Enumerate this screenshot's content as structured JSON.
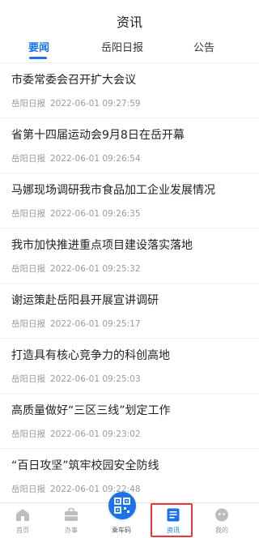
{
  "header": {
    "title": "资讯",
    "tabs": [
      {
        "label": "要闻",
        "active": true
      },
      {
        "label": "岳阳日报",
        "active": false
      },
      {
        "label": "公告",
        "active": false
      }
    ]
  },
  "news": [
    {
      "title": "市委常委会召开扩大会议",
      "source": "岳阳日报",
      "time": "2022-06-01 09:27:59"
    },
    {
      "title": "省第十四届运动会9月8日在岳开幕",
      "source": "岳阳日报",
      "time": "2022-06-01 09:26:54"
    },
    {
      "title": "马娜现场调研我市食品加工企业发展情况",
      "source": "岳阳日报",
      "time": "2022-06-01 09:26:35"
    },
    {
      "title": "我市加快推进重点项目建设落实落地",
      "source": "岳阳日报",
      "time": "2022-06-01 09:25:32"
    },
    {
      "title": "谢运策赴岳阳县开展宣讲调研",
      "source": "岳阳日报",
      "time": "2022-06-01 09:25:17"
    },
    {
      "title": "打造具有核心竞争力的科创高地",
      "source": "岳阳日报",
      "time": "2022-06-01 09:25:03"
    },
    {
      "title": "高质量做好“三区三线”划定工作",
      "source": "岳阳日报",
      "time": "2022-06-01 09:23:02"
    },
    {
      "title": "“百日攻坚”筑牢校园安全防线",
      "source": "岳阳日报",
      "time": "2022-06-01 09:22:48"
    }
  ],
  "tabbar": {
    "items": [
      {
        "label": "首页",
        "icon": "home-icon"
      },
      {
        "label": "办事",
        "icon": "briefcase-icon"
      },
      {
        "label": "乘车码",
        "icon": "qr-code-icon"
      },
      {
        "label": "资讯",
        "icon": "document-icon",
        "active": true
      },
      {
        "label": "我的",
        "icon": "user-icon"
      }
    ]
  },
  "colors": {
    "accent": "#1a73e8",
    "highlight": "#e53935",
    "meta": "#9a9a9a"
  }
}
